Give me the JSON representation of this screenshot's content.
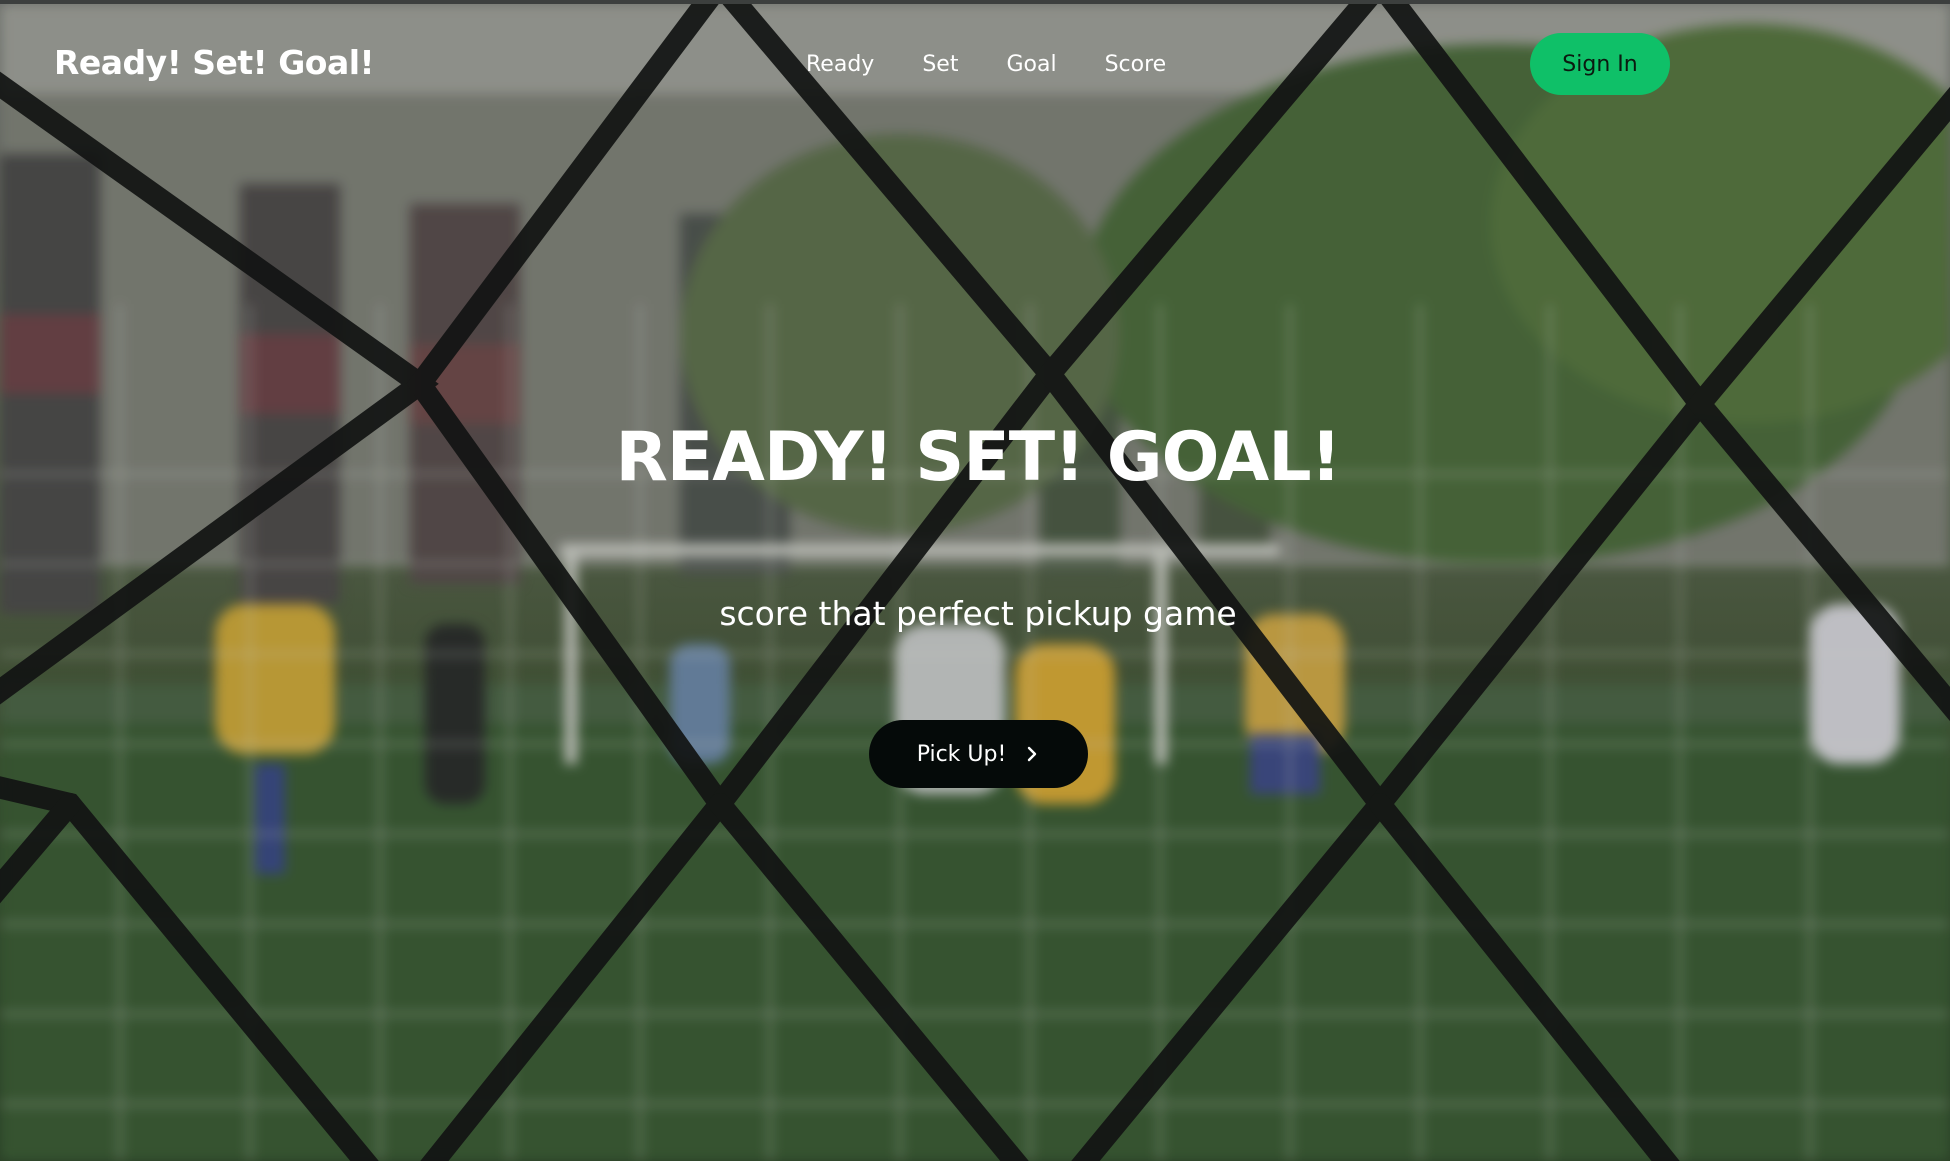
{
  "navbar": {
    "brand": "Ready! Set! Goal!",
    "links": [
      "Ready",
      "Set",
      "Goal",
      "Score"
    ],
    "signin_label": "Sign In"
  },
  "hero": {
    "title": "READY! SET! GOAL!",
    "subtitle": "score that perfect pickup game",
    "cta_label": "Pick Up!",
    "cta_icon": "chevron-right-icon",
    "background": "blurred soccer game behind chain-link fence"
  },
  "colors": {
    "signin_bg": "#0fc068",
    "cta_bg": "#050a09",
    "text": "#ffffff"
  }
}
